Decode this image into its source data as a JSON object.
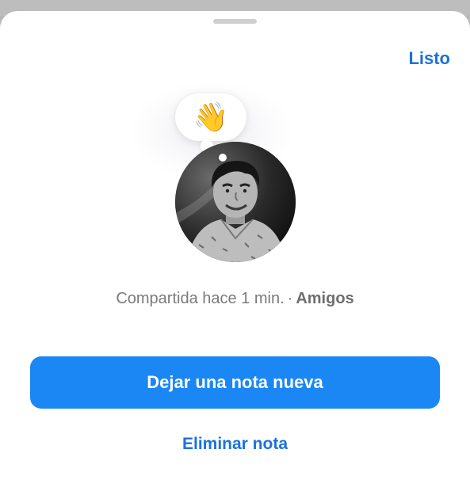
{
  "header": {
    "done_label": "Listo"
  },
  "note": {
    "emoji": "👋",
    "emoji_icon": "waving-hand-icon"
  },
  "status": {
    "shared_text": "Compartida hace 1 min.",
    "separator": "·",
    "audience": "Amigos"
  },
  "actions": {
    "new_note_label": "Dejar una nota nueva",
    "delete_note_label": "Eliminar nota"
  },
  "colors": {
    "accent": "#1a87f5",
    "link": "#1a73d9",
    "muted_text": "#7a7a7a"
  }
}
